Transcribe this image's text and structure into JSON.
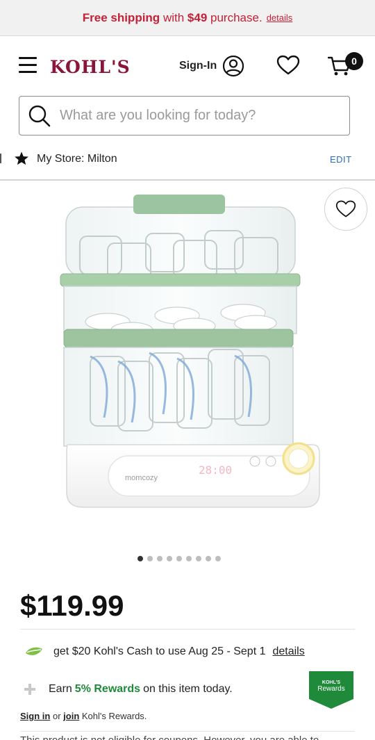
{
  "promo": {
    "prefix": "Free shipping",
    "middle": "with",
    "amount": "$49",
    "suffix": "purchase.",
    "details_link": "details",
    "color": "#c52036"
  },
  "header": {
    "logo": "KOHL'S",
    "signin_label": "Sign-In",
    "cart_count": "0",
    "icons": [
      "hamburger-menu-icon",
      "account-icon",
      "heart-icon",
      "cart-icon"
    ],
    "brand_color": "#8a1538"
  },
  "search": {
    "placeholder": "What are you looking for today?",
    "value": ""
  },
  "store": {
    "label": "My Store: Milton",
    "edit_label": "EDIT"
  },
  "product": {
    "image_brand_text": "momcozy",
    "display_time": "28:00",
    "image_count": 9,
    "active_image_index": 0,
    "price": "$119.99"
  },
  "kohls_cash": {
    "text": "get $20 Kohl's Cash to use Aug 25 - Sept 1",
    "link": "details"
  },
  "rewards": {
    "earn_prefix": "Earn",
    "percent": "5% Rewards",
    "earn_suffix": "on this item today.",
    "badge_top": "KOHL'S",
    "badge_bottom": "Rewards",
    "accent_color": "#1e8a3a"
  },
  "signin_line": {
    "signin_link": "Sign in",
    "or": "or",
    "join_link": "join",
    "suffix": "Kohl's Rewards."
  },
  "coupon_text": "This product is not eligible for coupons. However, you are able to"
}
